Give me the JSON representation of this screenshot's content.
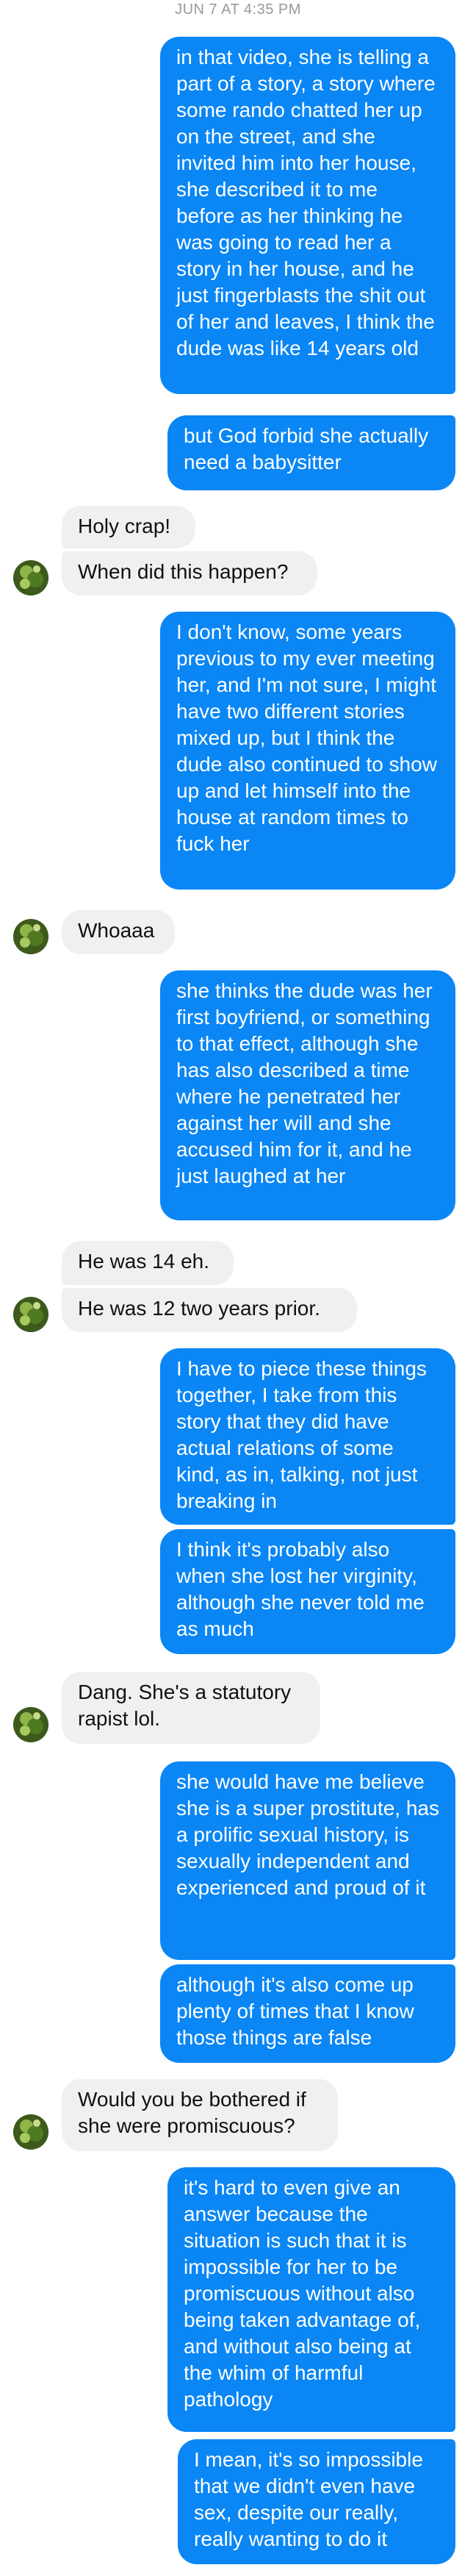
{
  "timestamp": "JUN 7 AT 4:35 PM",
  "messages": [
    {
      "from": "me",
      "text": "in that video, she is telling a part of a story, a story where some rando chatted her up on the street, and she invited him into her house, she described it to me before as her thinking he was going to read her a story in her house, and he just fingerblasts the shit out of her and leaves, I think the dude was like 14 years old"
    },
    {
      "from": "me",
      "text": "but God forbid she actually need a babysitter"
    },
    {
      "from": "them",
      "text": "Holy crap!"
    },
    {
      "from": "them",
      "text": "When did this happen?"
    },
    {
      "from": "me",
      "text": "I don't know, some years previous to my ever meeting her, and I'm not sure, I might have two different stories mixed up, but I think the dude also continued to show up and let himself into the house at random times to fuck her"
    },
    {
      "from": "them",
      "text": "Whoaaa"
    },
    {
      "from": "me",
      "text": "she thinks the dude was her first boyfriend, or something to that effect, although she has also described a time where he penetrated her against her will and she accused him for it, and he just laughed at her"
    },
    {
      "from": "them",
      "text": "He was 14 eh."
    },
    {
      "from": "them",
      "text": "He was 12 two years prior."
    },
    {
      "from": "me",
      "text": "I have to piece these things together, I take from this story that they did have actual relations of some kind, as in, talking, not just breaking in"
    },
    {
      "from": "me",
      "text": "I think it's probably also when she lost her virginity, although she never told me as much"
    },
    {
      "from": "them",
      "text": "Dang. She's a statutory rapist lol."
    },
    {
      "from": "me",
      "text": "she would have me believe she is a super prostitute, has a prolific sexual history, is sexually independent and experienced and proud of it"
    },
    {
      "from": "me",
      "text": "although it's also come up plenty of times that I know those things are false"
    },
    {
      "from": "them",
      "text": "Would you be bothered if she were promiscuous?"
    },
    {
      "from": "me",
      "text": "it's hard to even give an answer because the situation is such that it is impossible for her to be promiscuous without also being taken advantage of, and without also being at the whim of harmful pathology"
    },
    {
      "from": "me",
      "text": "I mean, it's so impossible that we didn't even have sex, despite our really, really wanting to do it"
    }
  ],
  "colors": {
    "outgoing": "#0a86f5",
    "incoming": "#f1f0f0"
  },
  "icons": {
    "avatar": "contact-avatar-green-photo"
  }
}
